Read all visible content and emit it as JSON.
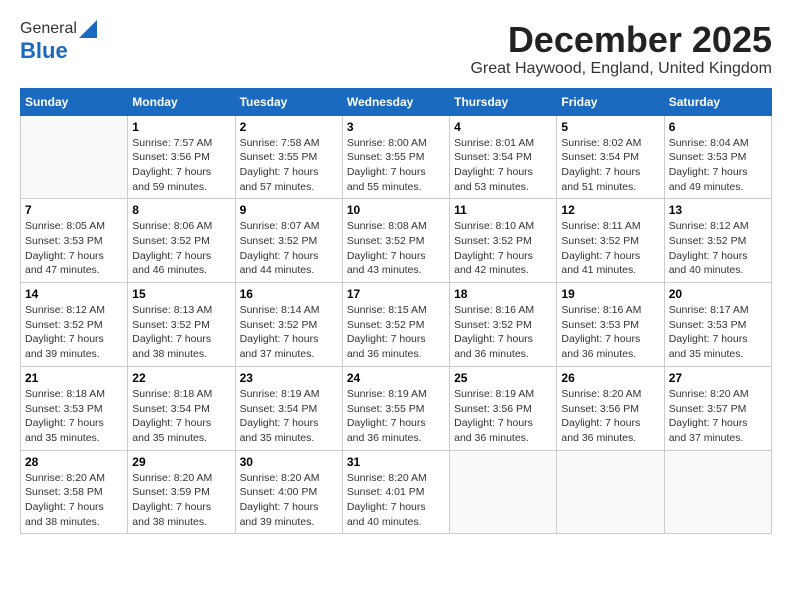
{
  "header": {
    "logo_general": "General",
    "logo_blue": "Blue",
    "month_title": "December 2025",
    "location": "Great Haywood, England, United Kingdom"
  },
  "days_of_week": [
    "Sunday",
    "Monday",
    "Tuesday",
    "Wednesday",
    "Thursday",
    "Friday",
    "Saturday"
  ],
  "weeks": [
    [
      {
        "day": "",
        "info": ""
      },
      {
        "day": "1",
        "info": "Sunrise: 7:57 AM\nSunset: 3:56 PM\nDaylight: 7 hours\nand 59 minutes."
      },
      {
        "day": "2",
        "info": "Sunrise: 7:58 AM\nSunset: 3:55 PM\nDaylight: 7 hours\nand 57 minutes."
      },
      {
        "day": "3",
        "info": "Sunrise: 8:00 AM\nSunset: 3:55 PM\nDaylight: 7 hours\nand 55 minutes."
      },
      {
        "day": "4",
        "info": "Sunrise: 8:01 AM\nSunset: 3:54 PM\nDaylight: 7 hours\nand 53 minutes."
      },
      {
        "day": "5",
        "info": "Sunrise: 8:02 AM\nSunset: 3:54 PM\nDaylight: 7 hours\nand 51 minutes."
      },
      {
        "day": "6",
        "info": "Sunrise: 8:04 AM\nSunset: 3:53 PM\nDaylight: 7 hours\nand 49 minutes."
      }
    ],
    [
      {
        "day": "7",
        "info": "Sunrise: 8:05 AM\nSunset: 3:53 PM\nDaylight: 7 hours\nand 47 minutes."
      },
      {
        "day": "8",
        "info": "Sunrise: 8:06 AM\nSunset: 3:52 PM\nDaylight: 7 hours\nand 46 minutes."
      },
      {
        "day": "9",
        "info": "Sunrise: 8:07 AM\nSunset: 3:52 PM\nDaylight: 7 hours\nand 44 minutes."
      },
      {
        "day": "10",
        "info": "Sunrise: 8:08 AM\nSunset: 3:52 PM\nDaylight: 7 hours\nand 43 minutes."
      },
      {
        "day": "11",
        "info": "Sunrise: 8:10 AM\nSunset: 3:52 PM\nDaylight: 7 hours\nand 42 minutes."
      },
      {
        "day": "12",
        "info": "Sunrise: 8:11 AM\nSunset: 3:52 PM\nDaylight: 7 hours\nand 41 minutes."
      },
      {
        "day": "13",
        "info": "Sunrise: 8:12 AM\nSunset: 3:52 PM\nDaylight: 7 hours\nand 40 minutes."
      }
    ],
    [
      {
        "day": "14",
        "info": "Sunrise: 8:12 AM\nSunset: 3:52 PM\nDaylight: 7 hours\nand 39 minutes."
      },
      {
        "day": "15",
        "info": "Sunrise: 8:13 AM\nSunset: 3:52 PM\nDaylight: 7 hours\nand 38 minutes."
      },
      {
        "day": "16",
        "info": "Sunrise: 8:14 AM\nSunset: 3:52 PM\nDaylight: 7 hours\nand 37 minutes."
      },
      {
        "day": "17",
        "info": "Sunrise: 8:15 AM\nSunset: 3:52 PM\nDaylight: 7 hours\nand 36 minutes."
      },
      {
        "day": "18",
        "info": "Sunrise: 8:16 AM\nSunset: 3:52 PM\nDaylight: 7 hours\nand 36 minutes."
      },
      {
        "day": "19",
        "info": "Sunrise: 8:16 AM\nSunset: 3:53 PM\nDaylight: 7 hours\nand 36 minutes."
      },
      {
        "day": "20",
        "info": "Sunrise: 8:17 AM\nSunset: 3:53 PM\nDaylight: 7 hours\nand 35 minutes."
      }
    ],
    [
      {
        "day": "21",
        "info": "Sunrise: 8:18 AM\nSunset: 3:53 PM\nDaylight: 7 hours\nand 35 minutes."
      },
      {
        "day": "22",
        "info": "Sunrise: 8:18 AM\nSunset: 3:54 PM\nDaylight: 7 hours\nand 35 minutes."
      },
      {
        "day": "23",
        "info": "Sunrise: 8:19 AM\nSunset: 3:54 PM\nDaylight: 7 hours\nand 35 minutes."
      },
      {
        "day": "24",
        "info": "Sunrise: 8:19 AM\nSunset: 3:55 PM\nDaylight: 7 hours\nand 36 minutes."
      },
      {
        "day": "25",
        "info": "Sunrise: 8:19 AM\nSunset: 3:56 PM\nDaylight: 7 hours\nand 36 minutes."
      },
      {
        "day": "26",
        "info": "Sunrise: 8:20 AM\nSunset: 3:56 PM\nDaylight: 7 hours\nand 36 minutes."
      },
      {
        "day": "27",
        "info": "Sunrise: 8:20 AM\nSunset: 3:57 PM\nDaylight: 7 hours\nand 37 minutes."
      }
    ],
    [
      {
        "day": "28",
        "info": "Sunrise: 8:20 AM\nSunset: 3:58 PM\nDaylight: 7 hours\nand 38 minutes."
      },
      {
        "day": "29",
        "info": "Sunrise: 8:20 AM\nSunset: 3:59 PM\nDaylight: 7 hours\nand 38 minutes."
      },
      {
        "day": "30",
        "info": "Sunrise: 8:20 AM\nSunset: 4:00 PM\nDaylight: 7 hours\nand 39 minutes."
      },
      {
        "day": "31",
        "info": "Sunrise: 8:20 AM\nSunset: 4:01 PM\nDaylight: 7 hours\nand 40 minutes."
      },
      {
        "day": "",
        "info": ""
      },
      {
        "day": "",
        "info": ""
      },
      {
        "day": "",
        "info": ""
      }
    ]
  ]
}
